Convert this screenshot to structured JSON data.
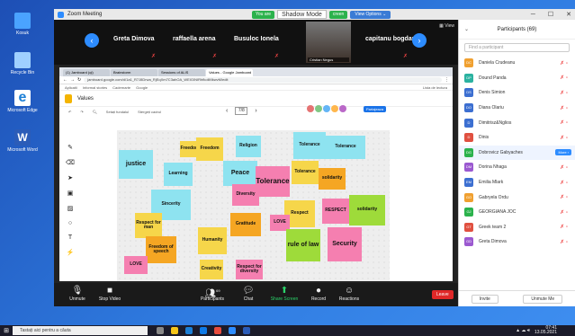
{
  "zoom": {
    "title": "Zoom Meeting",
    "you_are_viewing": "You are",
    "shadow_mode": "Shadow Mode",
    "screen_label": "creen",
    "view_options": "View Options ⌄",
    "view_label": "View"
  },
  "gallery": {
    "names": [
      "Greta Dimova",
      "raffaella arena",
      "Busuloc Ionela",
      "capitanu bogdan"
    ],
    "camera_label": "Cristian Negus"
  },
  "browser": {
    "tabs": [
      "(1) Jamboard (ql)",
      "Brainstorm",
      "Sessions of ALIS",
      "Values - Google Jamboard",
      ""
    ],
    "url": "jamboard.google.com/d/1a1_R7J8Drwa_RjEqXm7C3ahOA_WEIGINIRhfkoliMkwvM/edit",
    "bookmarks": [
      "Aplicatii",
      "Informal stories",
      "Cadernarte",
      "Google"
    ],
    "reading_list": "Lista de lectura"
  },
  "jamboard": {
    "title": "Values",
    "page": "7/8",
    "share_label": "Partajeaza",
    "toolrow": [
      "Setați fundalul",
      "Stergeți cadrul"
    ]
  },
  "notes": [
    {
      "text": "Freedom",
      "color": "#f6d64a"
    },
    {
      "text": "Religion",
      "color": "#8ee3f0"
    },
    {
      "text": "Tolerance",
      "color": "#8ee3f0"
    },
    {
      "text": "justice",
      "color": "#8ee3f0"
    },
    {
      "text": "Learning",
      "color": "#8ee3f0"
    },
    {
      "text": "Peace",
      "color": "#8ee3f0"
    },
    {
      "text": "Tolerance",
      "color": "#f57fb0"
    },
    {
      "text": "Tolerance",
      "color": "#f6d64a"
    },
    {
      "text": "solidarity",
      "color": "#f5a623"
    },
    {
      "text": "Diversity",
      "color": "#f57fb0"
    },
    {
      "text": "Sincerity",
      "color": "#8ee3f0"
    },
    {
      "text": "Respect",
      "color": "#f6d64a"
    },
    {
      "text": "RESPECT",
      "color": "#f57fb0"
    },
    {
      "text": "solidarity",
      "color": "#9edb3a"
    },
    {
      "text": "Respect for man",
      "color": "#f6d64a"
    },
    {
      "text": "Gratitude",
      "color": "#f5a623"
    },
    {
      "text": "LOVE",
      "color": "#f57fb0"
    },
    {
      "text": "rule of law",
      "color": "#9edb3a"
    },
    {
      "text": "Security",
      "color": "#f57fb0"
    },
    {
      "text": "Freedom of speech",
      "color": "#f5a623"
    },
    {
      "text": "Humanity",
      "color": "#f6d64a"
    },
    {
      "text": "LOVE",
      "color": "#f57fb0"
    },
    {
      "text": "Creativity",
      "color": "#f6d64a"
    },
    {
      "text": "Respect for diversity",
      "color": "#f57fb0"
    }
  ],
  "toolbar": {
    "unmute": "Unmute",
    "stop_video": "Stop Video",
    "participants": "Participants",
    "participants_count": "69",
    "chat": "Chat",
    "share_screen": "Share Screen",
    "record": "Record",
    "reactions": "Reactions",
    "leave": "Leave"
  },
  "panel": {
    "title": "Participants (69)",
    "find_placeholder": "Find a participant",
    "participants": [
      {
        "initials": "DC",
        "name": "Daniela Crudeanu",
        "color": "#f0a030"
      },
      {
        "initials": "DP",
        "name": "Dound Panda",
        "color": "#2bb2a0"
      },
      {
        "initials": "DS",
        "name": "Denis Simion",
        "color": "#3c6fd1"
      },
      {
        "initials": "DO",
        "name": "Diana Olariu",
        "color": "#3c6fd1"
      },
      {
        "initials": "D",
        "name": "Dimitrisz&Nglios",
        "color": "#3c6fd1"
      },
      {
        "initials": "D",
        "name": "Dinis",
        "color": "#e05040"
      },
      {
        "initials": "DG",
        "name": "Dobrovicz Gabyaches",
        "color": "#2bb24c"
      },
      {
        "initials": "DM",
        "name": "Dorina Nhaga",
        "color": "#9b59d0"
      },
      {
        "initials": "EM",
        "name": "Emilia Mlark",
        "color": "#3c6fd1"
      },
      {
        "initials": "GO",
        "name": "Gabryela Ordu",
        "color": "#f0a030"
      },
      {
        "initials": "GJ",
        "name": "GEORGIANA JOC",
        "color": "#2bb24c"
      },
      {
        "initials": "GT",
        "name": "Greek team 2",
        "color": "#e05040"
      },
      {
        "initials": "GD",
        "name": "Greta Dimova",
        "color": "#9b59d0"
      }
    ],
    "more_label": "More ›",
    "invite": "Invite",
    "unmute_me": "Unmute Me"
  },
  "desktop": {
    "icons": [
      "Kosuk",
      "Recycle Bin",
      "Microsoft Edge",
      "Microsoft Word"
    ]
  },
  "taskbar": {
    "search": "Tastați aici pentru a căuta",
    "time": "07:41",
    "date": "13.05.2021"
  }
}
